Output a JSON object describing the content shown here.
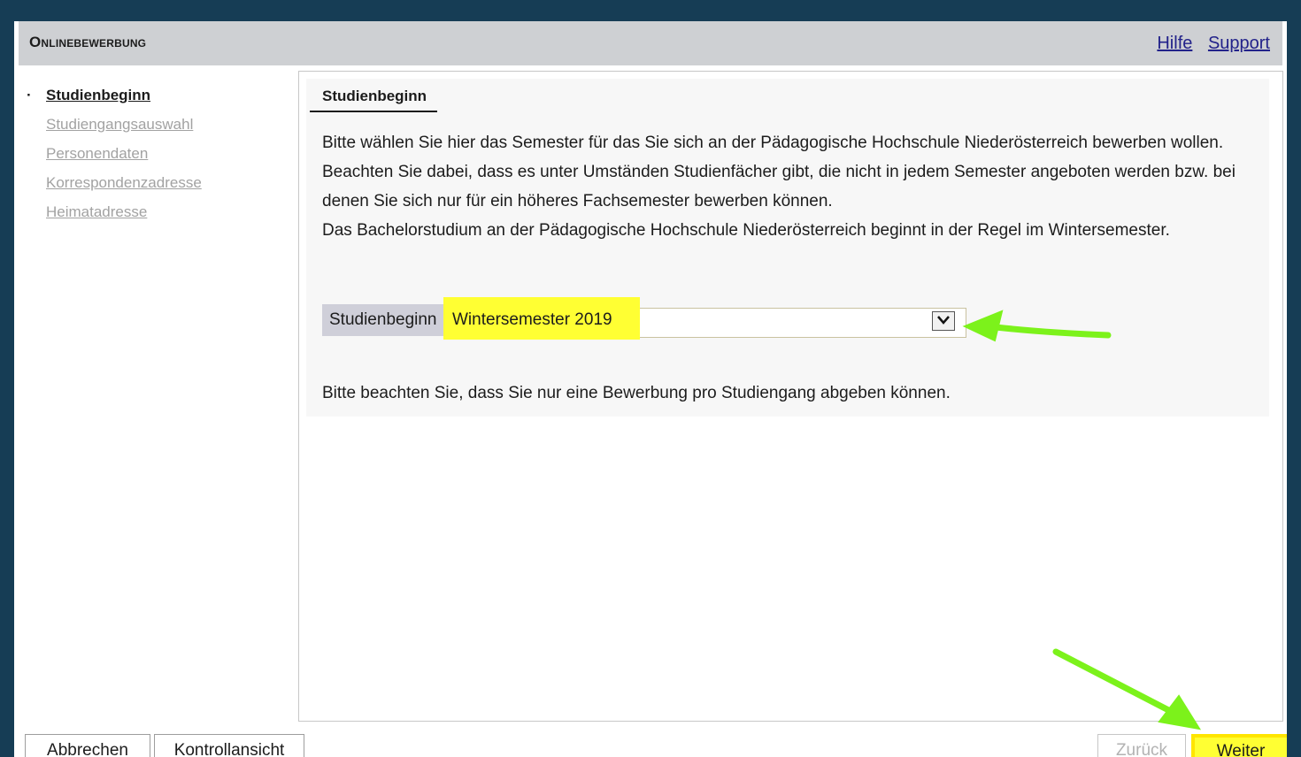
{
  "header": {
    "title": "Onlinebewerbung",
    "links": [
      "Hilfe",
      "Support"
    ]
  },
  "sidebar": {
    "items": [
      {
        "label": "Studienbeginn",
        "active": true
      },
      {
        "label": "Studiengangsauswahl",
        "active": false
      },
      {
        "label": "Personendaten",
        "active": false
      },
      {
        "label": "Korrespondenzadresse",
        "active": false
      },
      {
        "label": "Heimatadresse",
        "active": false
      }
    ]
  },
  "main": {
    "section_title": "Studienbeginn",
    "paragraphs": [
      "Bitte wählen Sie hier das Semester für das Sie sich an der Pädagogische Hochschule Niederösterreich bewerben wollen.",
      "Beachten Sie dabei, dass es unter Umständen Studienfächer gibt, die nicht in jedem Semester angeboten werden bzw. bei denen Sie sich nur für ein höheres Fachsemester bewerben können.",
      "Das Bachelorstudium an der Pädagogische Hochschule Niederösterreich beginnt in der Regel im Wintersemester."
    ],
    "field_label": "Studienbeginn",
    "select_value": "Wintersemester 2019",
    "note": "Bitte beachten Sie, dass Sie nur eine Bewerbung pro Studiengang abgeben können."
  },
  "footer": {
    "cancel_label": "Abbrechen",
    "control_label": "Kontrollansicht",
    "back_label": "Zurück",
    "next_label": "Weiter"
  },
  "colors": {
    "background": "#163d55",
    "highlight": "#ffff33",
    "arrow": "#7cf21b",
    "link": "#22228a"
  }
}
